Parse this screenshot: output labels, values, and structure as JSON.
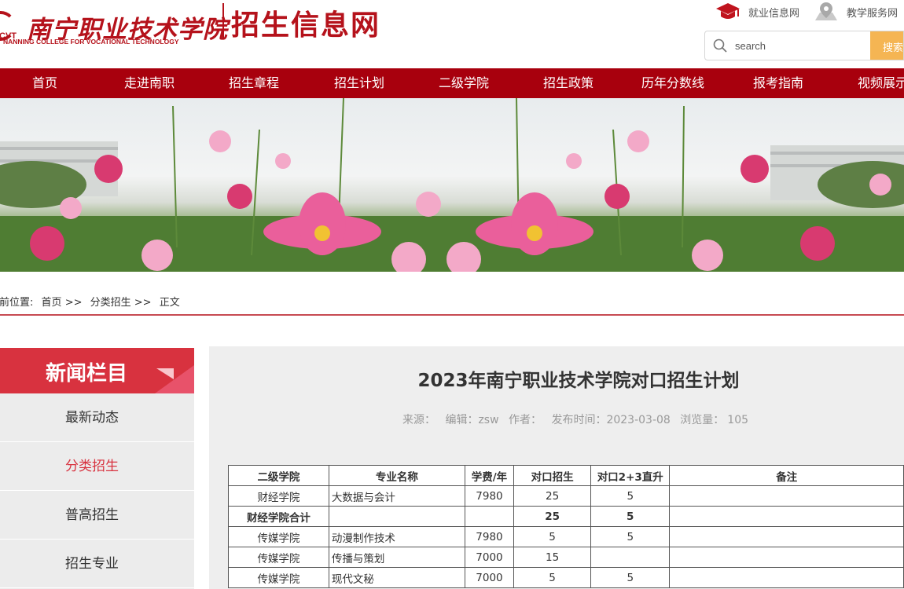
{
  "header": {
    "logo_cn": "南宁职业技术学院",
    "logo_en": "NANNING COLLEGE FOR VOCATIONAL TECHNOLOGY",
    "logo_abbr": "CVT",
    "site_title": "招生信息网",
    "top_links": [
      {
        "label": "就业信息网",
        "icon": "graduation-cap-icon"
      },
      {
        "label": "教学服务网",
        "icon": "map-pin-icon"
      }
    ],
    "search": {
      "placeholder": "search",
      "button": "搜索"
    }
  },
  "nav": {
    "items": [
      "首页",
      "走进南职",
      "招生章程",
      "招生计划",
      "二级学院",
      "招生政策",
      "历年分数线",
      "报考指南",
      "视频展示"
    ]
  },
  "breadcrumb": {
    "prefix": "当前位置:",
    "items": [
      "首页",
      ">>",
      "分类招生",
      ">>",
      "正文"
    ]
  },
  "sidebar": {
    "title": "新闻栏目",
    "items": [
      {
        "label": "最新动态",
        "active": false
      },
      {
        "label": "分类招生",
        "active": true
      },
      {
        "label": "普高招生",
        "active": false
      },
      {
        "label": "招生专业",
        "active": false
      }
    ]
  },
  "article": {
    "title": "2023年南宁职业技术学院对口招生计划",
    "meta": {
      "source": "来源：",
      "editor": "编辑：zsw",
      "author": "作者：",
      "published": "发布时间：2023-03-08",
      "views_label": "浏览量：",
      "views": "105"
    },
    "table": {
      "headers": [
        "二级学院",
        "专业名称",
        "学费/年",
        "对口招生",
        "对口2+3直升",
        "备注"
      ],
      "rows": [
        {
          "college": "财经学院",
          "major": "大数据与会计",
          "fee": "7980",
          "quota": "25",
          "direct": "5",
          "note": "",
          "sum": false
        },
        {
          "college": "财经学院合计",
          "major": "",
          "fee": "",
          "quota": "25",
          "direct": "5",
          "note": "",
          "sum": true
        },
        {
          "college": "传媒学院",
          "major": "动漫制作技术",
          "fee": "7980",
          "quota": "5",
          "direct": "5",
          "note": "",
          "sum": false
        },
        {
          "college": "传媒学院",
          "major": "传播与策划",
          "fee": "7000",
          "quota": "15",
          "direct": "",
          "note": "",
          "sum": false
        },
        {
          "college": "传媒学院",
          "major": "现代文秘",
          "fee": "7000",
          "quota": "5",
          "direct": "5",
          "note": "",
          "sum": false
        }
      ]
    }
  },
  "colors": {
    "brand_red": "#a8000d",
    "sidebar_red": "#d8323f",
    "search_button": "#f5b553"
  }
}
